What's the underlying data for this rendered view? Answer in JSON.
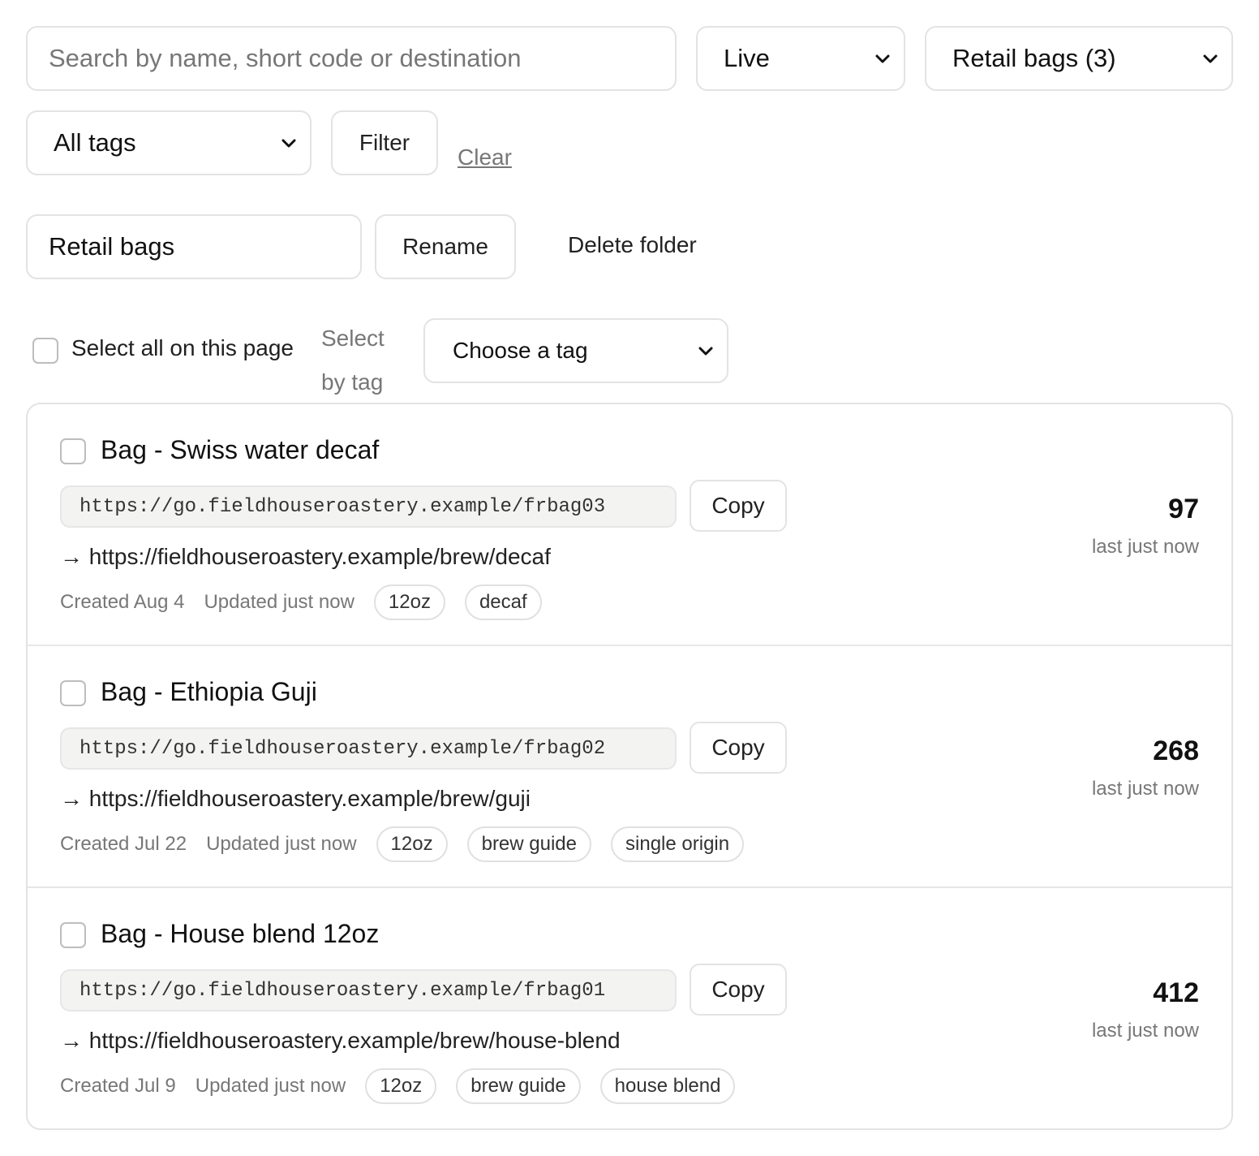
{
  "filters": {
    "search_placeholder": "Search by name, short code or destination",
    "status_selected": "Live",
    "folder_selected": "Retail bags (3)",
    "tags_selected": "All tags",
    "filter_label": "Filter",
    "clear_label": "Clear"
  },
  "folder": {
    "name_value": "Retail bags",
    "rename_label": "Rename",
    "delete_label": "Delete folder"
  },
  "bulk": {
    "select_all_label": "Select all on this page",
    "select_by_tag_label": "Select by tag",
    "choose_tag_placeholder": "Choose a tag"
  },
  "links": [
    {
      "title": "Bag - Swiss water decaf",
      "short_url": "https://go.fieldhouseroastery.example/frbag03",
      "copy_label": "Copy",
      "destination": "→ https://fieldhouseroastery.example/brew/decaf",
      "created": "Created Aug 4",
      "updated": "Updated just now",
      "tags": [
        "12oz",
        "decaf"
      ],
      "clicks": "97",
      "last": "last just now"
    },
    {
      "title": "Bag - Ethiopia Guji",
      "short_url": "https://go.fieldhouseroastery.example/frbag02",
      "copy_label": "Copy",
      "destination": "→ https://fieldhouseroastery.example/brew/guji",
      "created": "Created Jul 22",
      "updated": "Updated just now",
      "tags": [
        "12oz",
        "brew guide",
        "single origin"
      ],
      "clicks": "268",
      "last": "last just now"
    },
    {
      "title": "Bag - House blend 12oz",
      "short_url": "https://go.fieldhouseroastery.example/frbag01",
      "copy_label": "Copy",
      "destination": "→ https://fieldhouseroastery.example/brew/house-blend",
      "created": "Created Jul 9",
      "updated": "Updated just now",
      "tags": [
        "12oz",
        "brew guide",
        "house blend"
      ],
      "clicks": "412",
      "last": "last just now"
    }
  ]
}
